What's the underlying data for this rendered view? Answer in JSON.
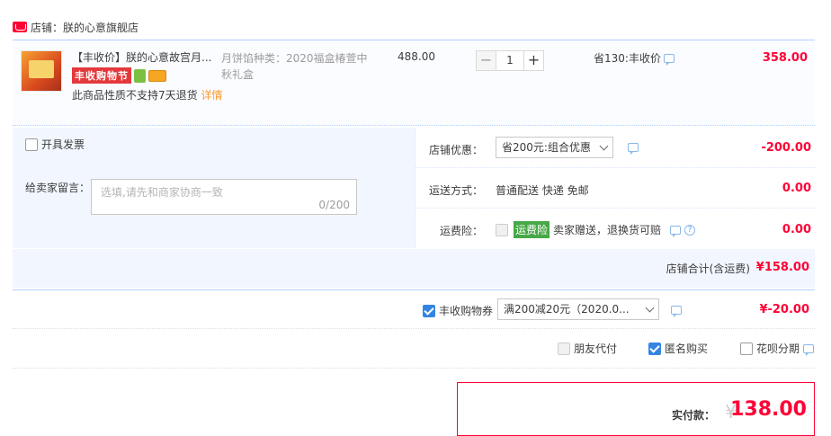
{
  "shop": {
    "name": "店铺：朕的心意旗舰店"
  },
  "item": {
    "title": "【丰收价】朕的心意故宫月...",
    "promo_badge": "丰收购物节",
    "notice": "此商品性质不支持7天退货",
    "notice_link": "详情",
    "sku": "月饼馅种类：2020福盒椿萱中秋礼盒",
    "unit_price": "488.00",
    "qty_minus": "−",
    "qty_value": "1",
    "qty_plus": "+",
    "save_text": "省130:丰收价",
    "subtotal": "358.00"
  },
  "extras": {
    "invoice_label": "开具发票",
    "message_label": "给卖家留言：",
    "message_placeholder": "选填,请先和商家协商一致",
    "message_count": "0/200",
    "shop_discount_label": "店铺优惠：",
    "shop_discount_value": "省200元:组合优惠",
    "shop_discount_price": "-200.00",
    "shipping_label": "运送方式：",
    "shipping_value": "普通配送 快递 免邮",
    "shipping_price": "0.00",
    "insurance_label": "运费险：",
    "insurance_tag": "运费险",
    "insurance_value": "卖家赠送，退换货可赔",
    "insurance_price": "0.00"
  },
  "total": {
    "label": "店铺合计(含运费)",
    "price": "¥158.00"
  },
  "coupon": {
    "label": "丰收购物券",
    "select_value": "满200减20元（2020.0...",
    "price": "¥-20.00"
  },
  "options": {
    "friend_pay": "朋友代付",
    "anonymous": "匿名购买",
    "huabei": "花呗分期"
  },
  "payment": {
    "label": "实付款：",
    "yen": "¥",
    "amount": "138.00"
  }
}
